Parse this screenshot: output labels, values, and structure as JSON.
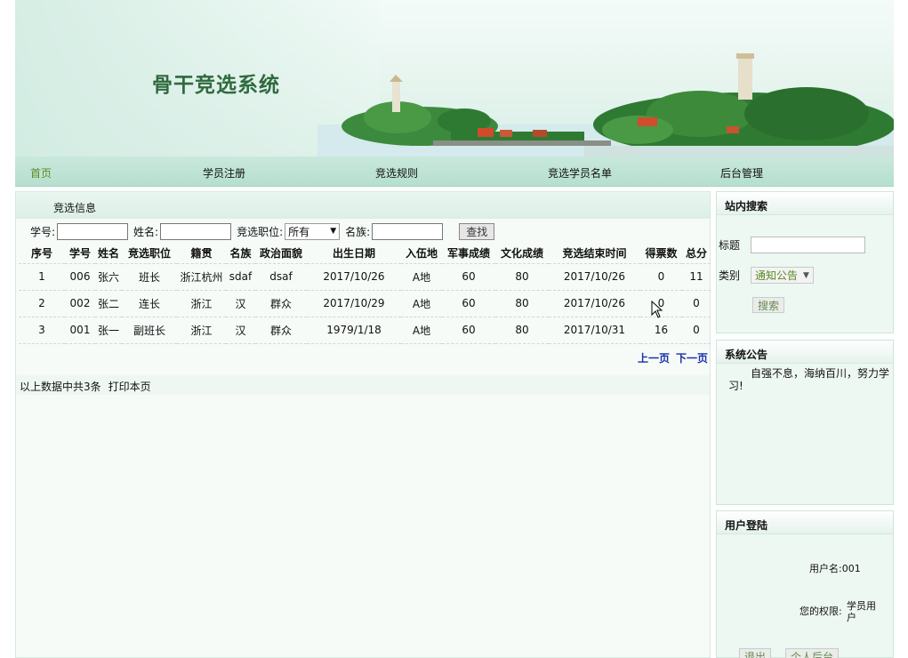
{
  "header": {
    "site_title": "骨干竞选系统"
  },
  "nav": {
    "items": [
      {
        "label": "首页",
        "active": true
      },
      {
        "label": "学员注册"
      },
      {
        "label": "竞选规则"
      },
      {
        "label": "竞选学员名单"
      },
      {
        "label": "后台管理"
      }
    ]
  },
  "main": {
    "title": "竞选信息",
    "filter": {
      "student_no_label": "学号:",
      "name_label": "姓名:",
      "position_label": "竞选职位:",
      "position_value": "所有",
      "ethnicity_label": "名族:",
      "search_button": "查找"
    },
    "table": {
      "columns": [
        "序号",
        "学号",
        "姓名",
        "竞选职位",
        "籍贯",
        "名族",
        "政治面貌",
        "出生日期",
        "入伍地",
        "军事成绩",
        "文化成绩",
        "竞选结束时间",
        "得票数",
        "总分"
      ],
      "rows": [
        [
          "1",
          "006",
          "张六",
          "班长",
          "浙江杭州",
          "sdaf",
          "dsaf",
          "2017/10/26",
          "A地",
          "60",
          "80",
          "2017/10/26",
          "0",
          "11"
        ],
        [
          "2",
          "002",
          "张二",
          "连长",
          "浙江",
          "汉",
          "群众",
          "2017/10/29",
          "A地",
          "60",
          "80",
          "2017/10/26",
          "0",
          "0"
        ],
        [
          "3",
          "001",
          "张一",
          "副班长",
          "浙江",
          "汉",
          "群众",
          "1979/1/18",
          "A地",
          "60",
          "80",
          "2017/10/31",
          "16",
          "0"
        ]
      ]
    },
    "pager": {
      "prev": "上一页",
      "next": "下一页"
    },
    "summary": {
      "count_text": "以上数据中共3条",
      "print": "打印本页"
    }
  },
  "sidebar": {
    "search": {
      "title": "站内搜索",
      "title_label": "标题",
      "category_label": "类别",
      "category_value": "通知公告",
      "button": "搜索"
    },
    "notice": {
      "title": "系统公告",
      "text": "自强不息，海纳百川，努力学习!"
    },
    "login": {
      "title": "用户登陆",
      "username_label": "用户名:",
      "username_value": "001",
      "role_label": "您的权限:",
      "role_value_line1": "学员用",
      "role_value_line2": "户",
      "logout_button": "退出",
      "personal_button": "个人后台"
    }
  },
  "colors": {
    "nav_bg": "#b5dfcf",
    "active_nav": "#5b8a22",
    "pager_link": "#1a2ea8",
    "title_green": "#2f6a3f"
  },
  "icons": [
    "dropdown-arrow-icon",
    "mouse-cursor-icon"
  ]
}
